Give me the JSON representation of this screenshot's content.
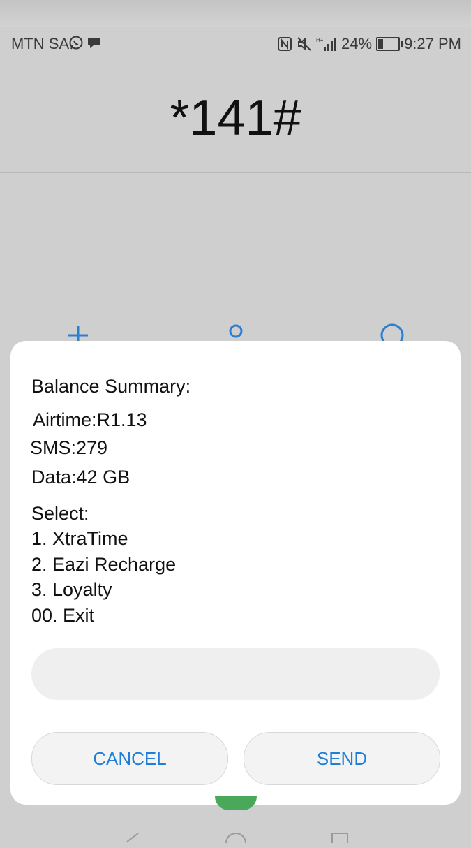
{
  "status_bar": {
    "carrier": "MTN SA",
    "left_icons": [
      "whatsapp-icon",
      "chat-bubble-icon"
    ],
    "right_icons": [
      "nfc-icon",
      "mute-icon",
      "signal-icon"
    ],
    "battery_percent": "24%",
    "battery_level": 0.24,
    "time": "9:27 PM"
  },
  "dialer": {
    "number": "*141#"
  },
  "ussd_dialog": {
    "lines": {
      "heading": "Balance Summary:",
      "airtime": "Airtime:R1.13",
      "sms": "SMS:279",
      "data": "Data:42 GB",
      "select": "Select:",
      "option_1": "1. XtraTime",
      "option_2": "2. Eazi Recharge",
      "option_3": "3. Loyalty",
      "option_exit": "00. Exit"
    },
    "input_value": "",
    "cancel_label": "CANCEL",
    "send_label": "SEND"
  },
  "colors": {
    "accent": "#1f7fd8",
    "call_green": "#4aa85a",
    "backdrop": "#cfcfcf"
  }
}
